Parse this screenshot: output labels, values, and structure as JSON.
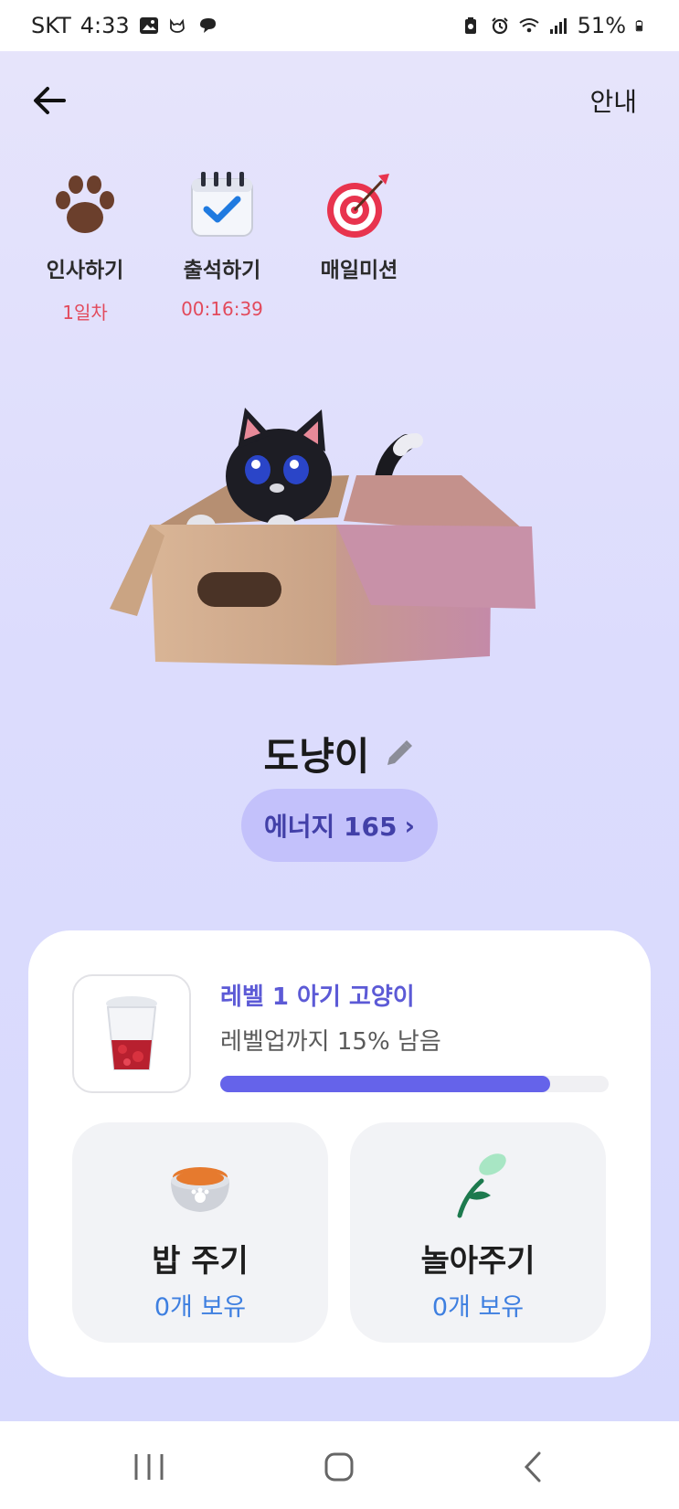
{
  "status_bar": {
    "carrier": "SKT",
    "time": "4:33",
    "battery": "51%"
  },
  "header": {
    "back_icon": "arrow-left-icon",
    "guide_label": "안내"
  },
  "actions": [
    {
      "label": "인사하기",
      "sub": "1일차",
      "icon": "paw-icon"
    },
    {
      "label": "출석하기",
      "sub": "00:16:39",
      "icon": "calendar-check-icon"
    },
    {
      "label": "매일미션",
      "sub": "",
      "icon": "target-icon"
    }
  ],
  "pet": {
    "name": "도냥이",
    "energy_label": "에너지 165",
    "energy_chevron": "›"
  },
  "level_card": {
    "title": "레벨 1 아기 고양이",
    "subtitle": "레벨업까지 15% 남음",
    "progress_fraction": 0.85,
    "accent_color": "#6563ea",
    "feed": {
      "title": "밥 주기",
      "count": "0개 보유",
      "icon": "food-bowl-icon"
    },
    "play": {
      "title": "놀아주기",
      "count": "0개 보유",
      "icon": "cat-toy-icon"
    }
  },
  "nav_bar": {
    "recent_icon": "recent-apps-icon",
    "home_icon": "home-icon",
    "back_icon": "back-chevron-icon"
  }
}
